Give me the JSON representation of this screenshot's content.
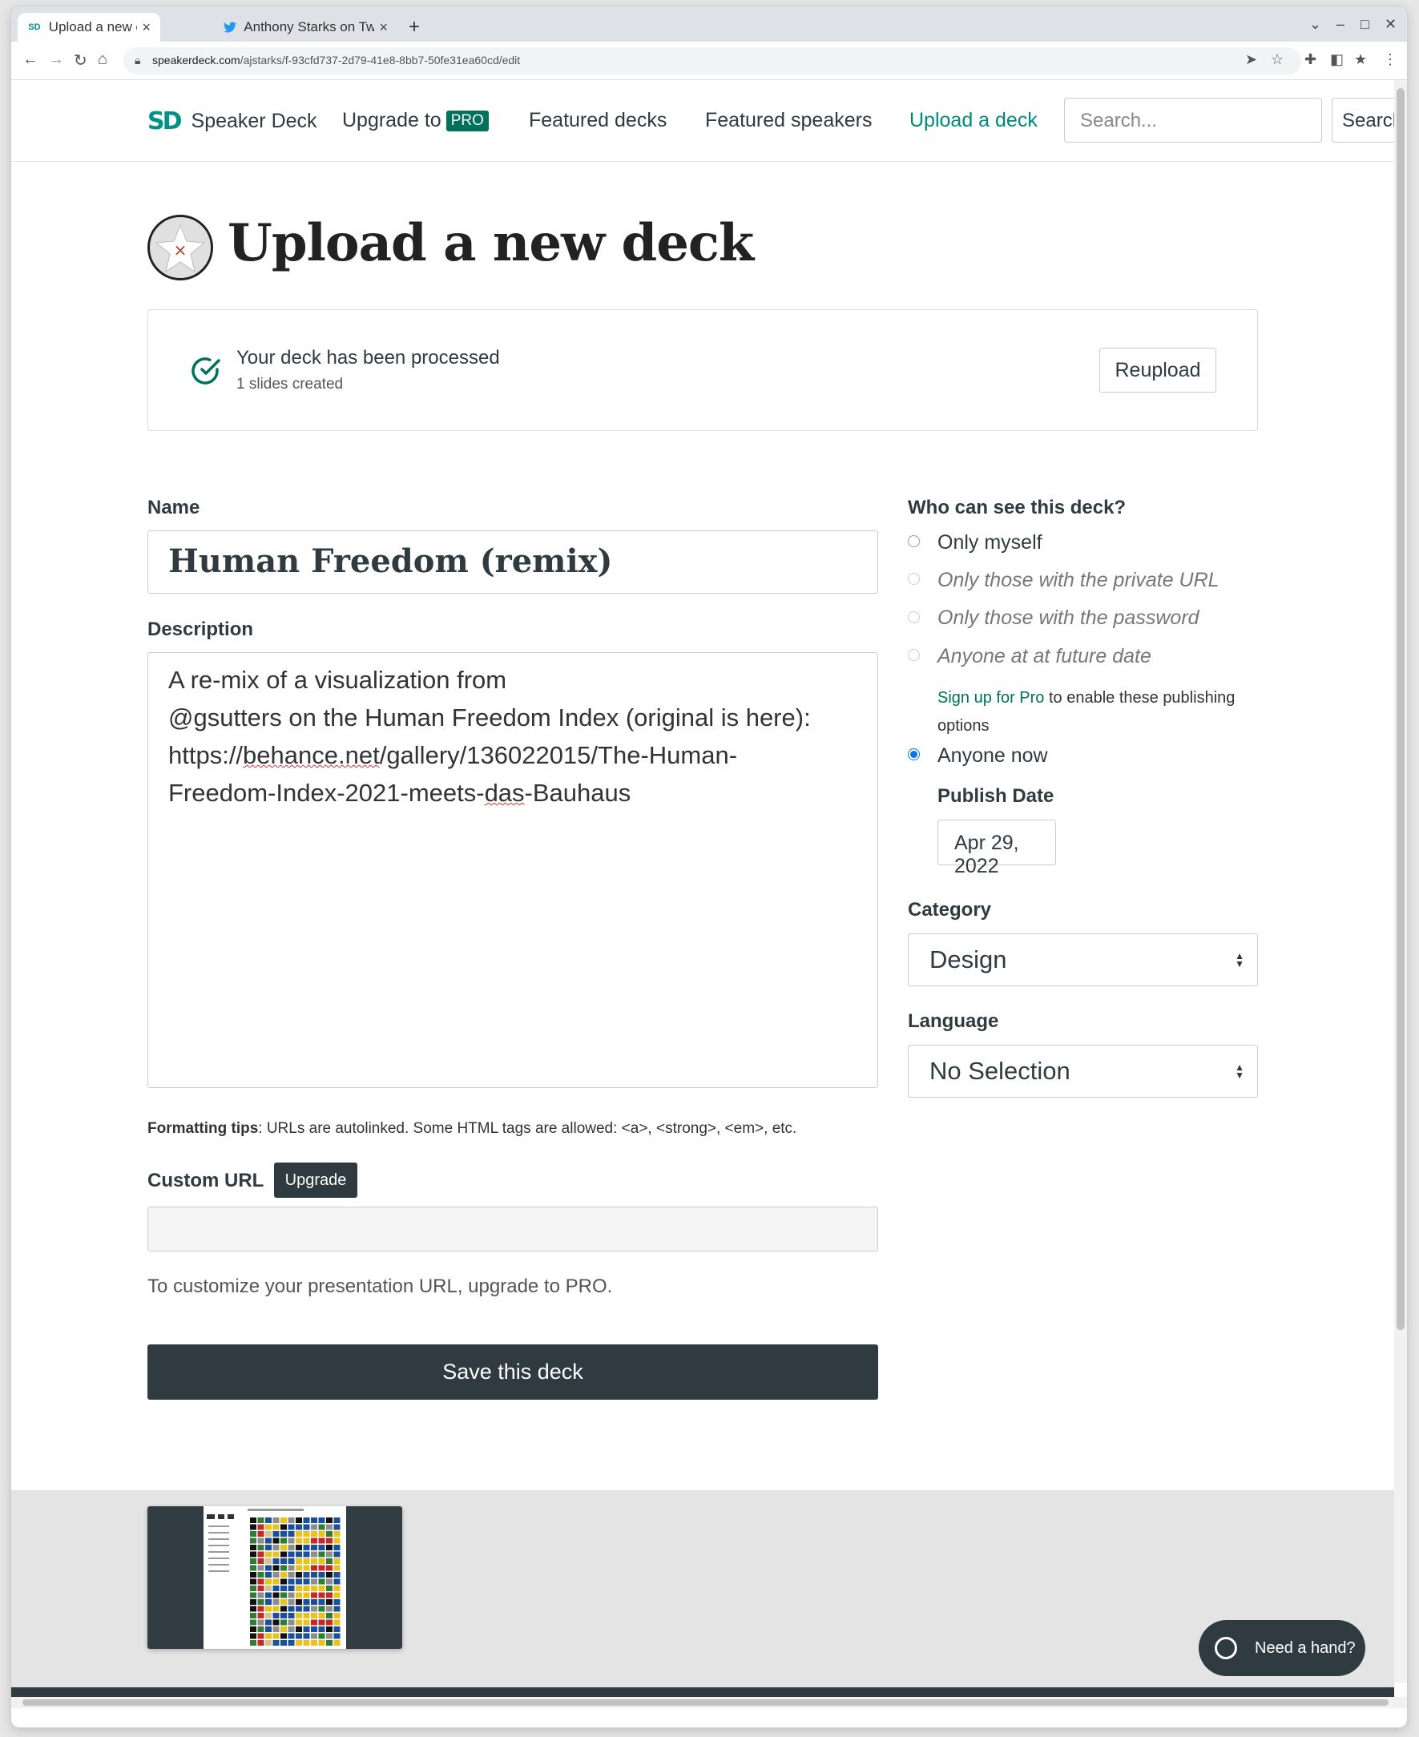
{
  "browser": {
    "tabs": [
      {
        "title": "Upload a new deck - Speaker Deck",
        "favicon": "speakerdeck-icon",
        "active": true
      },
      {
        "title": "Anthony Starks on Twitter",
        "favicon": "twitter-icon",
        "active": false
      }
    ],
    "url_domain": "speakerdeck.com",
    "url_path": "/ajstarks/f-93cfd737-2d79-41e8-8bb7-50fe31ea60cd/edit"
  },
  "header": {
    "logo_mark": "SD",
    "logo_text": "Speaker Deck",
    "upgrade_label": "Upgrade to",
    "pro_badge": "PRO",
    "featured_decks": "Featured decks",
    "featured_speakers": "Featured speakers",
    "upload_deck": "Upload a deck",
    "search_placeholder": "Search...",
    "search_button": "Search"
  },
  "page": {
    "title": "Upload a new deck",
    "status": {
      "title": "Your deck has been processed",
      "subtitle": "1 slides created",
      "reupload": "Reupload"
    },
    "name_label": "Name",
    "name_value": "Human Freedom (remix)",
    "description_label": "Description",
    "description": {
      "line1": "A re-mix of a visualization from",
      "line2_handle": "@gsutters",
      "line2_rest": " on the Human Freedom Index (original is here):",
      "line3_a": "https://",
      "line3_b": "behance.net",
      "line3_c": "/gallery/136022015/The-Human-",
      "line4_a": "Freedom-Index-2021-meets-",
      "line4_b": "das",
      "line4_c": "-Bauhaus"
    },
    "formatting_bold": "Formatting tips",
    "formatting_text": ": URLs are autolinked. Some HTML tags are allowed: <a>, <strong>, <em>, etc.",
    "custom_url_label": "Custom URL",
    "custom_url_upgrade": "Upgrade",
    "custom_url_value": "",
    "custom_url_hint": "To customize your presentation URL, upgrade to PRO.",
    "save_button": "Save this deck"
  },
  "visibility": {
    "label": "Who can see this deck?",
    "options": [
      {
        "label": "Only myself",
        "enabled": true,
        "checked": false
      },
      {
        "label": "Only those with the private URL",
        "enabled": false,
        "checked": false
      },
      {
        "label": "Only those with the password",
        "enabled": false,
        "checked": false
      },
      {
        "label": "Anyone at at future date",
        "enabled": false,
        "checked": false
      },
      {
        "label": "Anyone now",
        "enabled": true,
        "checked": true
      }
    ],
    "pro_link": "Sign up for Pro",
    "pro_text": " to enable these publishing options",
    "publish_date_label": "Publish Date",
    "publish_date": "Apr 29, 2022"
  },
  "category": {
    "label": "Category",
    "value": "Design"
  },
  "language": {
    "label": "Language",
    "value": "No Selection"
  },
  "help": {
    "label": "Need a hand?"
  },
  "colors": {
    "brand": "#009287",
    "dark": "#2f3b40",
    "pro": "#00725c",
    "radio": "#0b73e8"
  }
}
